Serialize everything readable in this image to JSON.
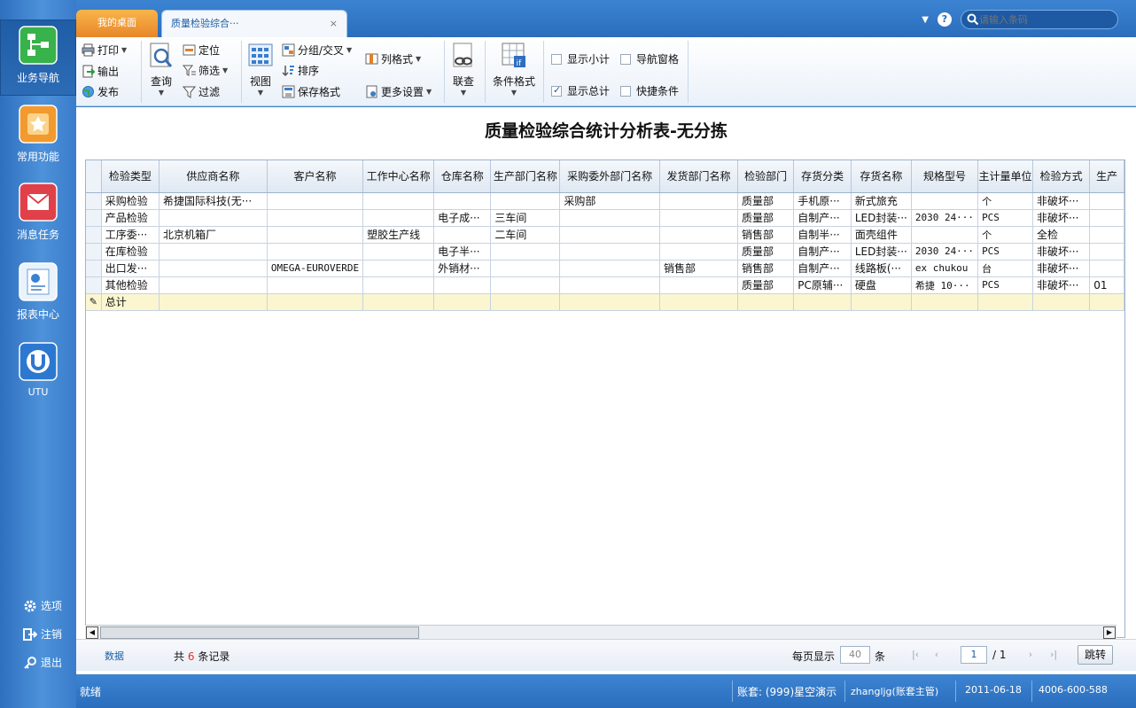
{
  "app": {
    "tabs": [
      {
        "label": "我的桌面"
      },
      {
        "label": "质量检验综合···"
      }
    ],
    "search_placeholder": "请输入条码"
  },
  "leftnav": {
    "items": [
      {
        "label": "业务导航",
        "icon": "business-nav-icon"
      },
      {
        "label": "常用功能",
        "icon": "star-icon"
      },
      {
        "label": "消息任务",
        "icon": "mail-icon"
      },
      {
        "label": "报表中心",
        "icon": "report-icon"
      },
      {
        "label": "UTU",
        "icon": "utu-icon"
      }
    ],
    "bottom": [
      {
        "label": "选项",
        "icon": "gear-icon"
      },
      {
        "label": "注销",
        "icon": "logout-icon"
      },
      {
        "label": "退出",
        "icon": "exit-key-icon"
      }
    ]
  },
  "toolbar": {
    "print": "打印",
    "export": "输出",
    "publish": "发布",
    "query": "查询",
    "locate": "定位",
    "filter_select": "筛选",
    "filter": "过滤",
    "view": "视图",
    "group_cross": "分组/交叉",
    "sort": "排序",
    "save_format": "保存格式",
    "column_format": "列格式",
    "more_settings": "更多设置",
    "linked_query": "联查",
    "condition_format": "条件格式",
    "show_subtotal": "显示小计",
    "nav_pane": "导航窗格",
    "show_total": "显示总计",
    "quick_condition": "快捷条件"
  },
  "report": {
    "title": "质量检验综合统计分析表-无分拣",
    "columns": [
      "检验类型",
      "供应商名称",
      "客户名称",
      "工作中心名称",
      "仓库名称",
      "生产部门名称",
      "采购委外部门名称",
      "发货部门名称",
      "检验部门",
      "存货分类",
      "存货名称",
      "规格型号",
      "主计量单位",
      "检验方式",
      "生产"
    ],
    "rows": [
      [
        "采购检验",
        "希捷国际科技(无···",
        "",
        "",
        "",
        "",
        "采购部",
        "",
        "质量部",
        "手机原···",
        "新式旅充",
        "",
        "个",
        "非破坏···",
        ""
      ],
      [
        "产品检验",
        "",
        "",
        "",
        "电子成···",
        "三车间",
        "",
        "",
        "质量部",
        "自制产···",
        "LED封装···",
        "2030 24···",
        "PCS",
        "非破坏···",
        ""
      ],
      [
        "工序委···",
        "北京机箱厂",
        "",
        "塑胶生产线",
        "",
        "二车间",
        "",
        "",
        "销售部",
        "自制半···",
        "面壳组件",
        "",
        "个",
        "全检",
        ""
      ],
      [
        "在库检验",
        "",
        "",
        "",
        "电子半···",
        "",
        "",
        "",
        "质量部",
        "自制产···",
        "LED封装···",
        "2030 24···",
        "PCS",
        "非破坏···",
        ""
      ],
      [
        "出口发···",
        "",
        "OMEGA-EUROVERDE",
        "",
        "外销材···",
        "",
        "",
        "销售部",
        "销售部",
        "自制产···",
        "线路板(···",
        "ex chukou",
        "台",
        "非破坏···",
        ""
      ],
      [
        "其他检验",
        "",
        "",
        "",
        "",
        "",
        "",
        "",
        "质量部",
        "PC原辅···",
        "硬盘",
        "希捷 10···",
        "PCS",
        "非破坏···",
        "01"
      ]
    ],
    "total_label": "总计"
  },
  "pager": {
    "data_link": "数据",
    "records_prefix": "共",
    "records_count": "6",
    "records_suffix": "条记录",
    "per_page_label": "每页显示",
    "per_page_value": "40",
    "per_page_unit": "条",
    "current_page": "1",
    "total_pages": "/ 1",
    "jump": "跳转"
  },
  "status": {
    "ready": "就绪",
    "account": "账套: (999)星空演示",
    "user": "zhangljg(账套主管)",
    "date": "2011-06-18",
    "phone": "4006-600-588"
  }
}
